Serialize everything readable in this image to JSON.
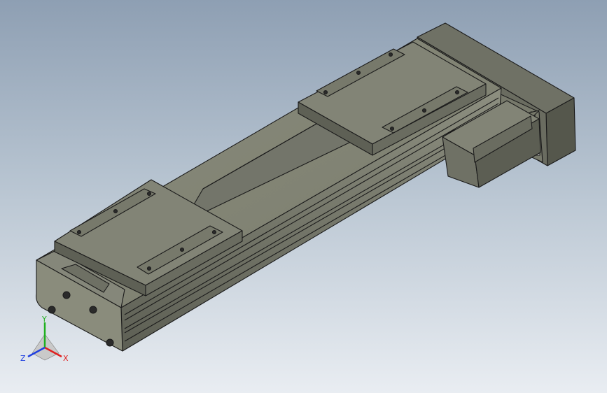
{
  "viewport": {
    "background_top": "#8e9fb3",
    "background_bottom": "#e9edf2",
    "model_color": "#7d7f70",
    "edge_color": "#1b1b1b"
  },
  "triad": {
    "x_label": "X",
    "y_label": "Y",
    "z_label": "Z",
    "x_color": "#e02020",
    "y_color": "#20b020",
    "z_color": "#2040e0"
  }
}
